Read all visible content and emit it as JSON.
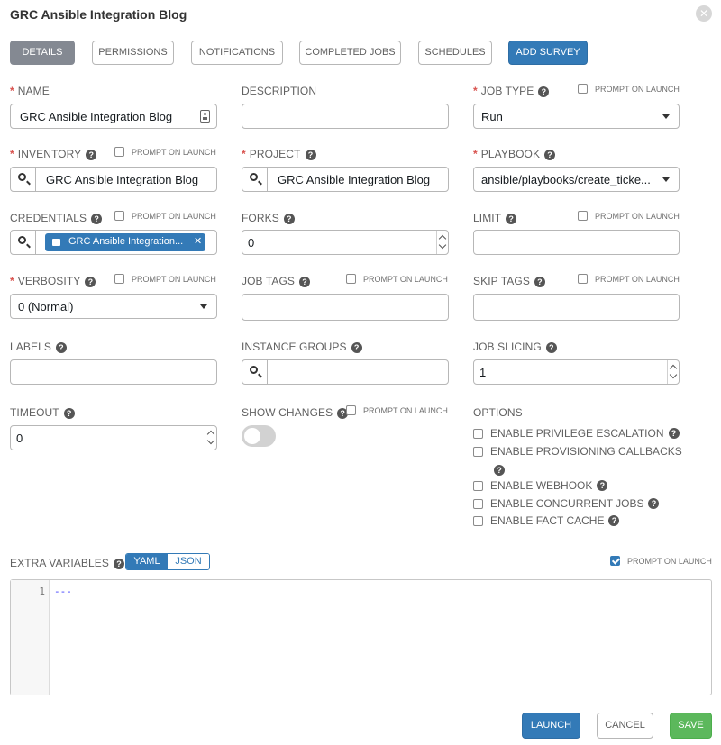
{
  "modal": {
    "title": "GRC Ansible Integration Blog"
  },
  "tabs": [
    "DETAILS",
    "PERMISSIONS",
    "NOTIFICATIONS",
    "COMPLETED JOBS",
    "SCHEDULES",
    "ADD SURVEY"
  ],
  "prompt_on_launch": "PROMPT ON LAUNCH",
  "fields": {
    "name": {
      "label": "NAME",
      "value": "GRC Ansible Integration Blog"
    },
    "description": {
      "label": "DESCRIPTION",
      "value": ""
    },
    "job_type": {
      "label": "JOB TYPE",
      "value": "Run"
    },
    "inventory": {
      "label": "INVENTORY",
      "value": "GRC Ansible Integration Blog"
    },
    "project": {
      "label": "PROJECT",
      "value": "GRC Ansible Integration Blog"
    },
    "playbook": {
      "label": "PLAYBOOK",
      "value": "ansible/playbooks/create_ticke..."
    },
    "credentials": {
      "label": "CREDENTIALS",
      "chip": "GRC Ansible Integration..."
    },
    "forks": {
      "label": "FORKS",
      "value": "0"
    },
    "limit": {
      "label": "LIMIT",
      "value": ""
    },
    "verbosity": {
      "label": "VERBOSITY",
      "value": "0 (Normal)"
    },
    "job_tags": {
      "label": "JOB TAGS",
      "value": ""
    },
    "skip_tags": {
      "label": "SKIP TAGS",
      "value": ""
    },
    "labels": {
      "label": "LABELS",
      "value": ""
    },
    "instance_groups": {
      "label": "INSTANCE GROUPS",
      "value": ""
    },
    "job_slicing": {
      "label": "JOB SLICING",
      "value": "1"
    },
    "timeout": {
      "label": "TIMEOUT",
      "value": "0"
    },
    "show_changes": {
      "label": "SHOW CHANGES",
      "on": false
    }
  },
  "options": {
    "label": "OPTIONS",
    "items": [
      "ENABLE PRIVILEGE ESCALATION",
      "ENABLE PROVISIONING CALLBACKS",
      "ENABLE WEBHOOK",
      "ENABLE CONCURRENT JOBS",
      "ENABLE FACT CACHE"
    ]
  },
  "extra_variables": {
    "label": "EXTRA VARIABLES",
    "modes": [
      "YAML",
      "JSON"
    ],
    "selected_mode": "YAML",
    "prompt_on_launch_checked": true,
    "line_number": "1",
    "content": "---"
  },
  "actions": {
    "launch": "LAUNCH",
    "cancel": "CANCEL",
    "save": "SAVE"
  },
  "colors": {
    "primary": "#337ab7",
    "success": "#5cb85c",
    "required": "#d9534f",
    "active_tab": "#848992"
  }
}
